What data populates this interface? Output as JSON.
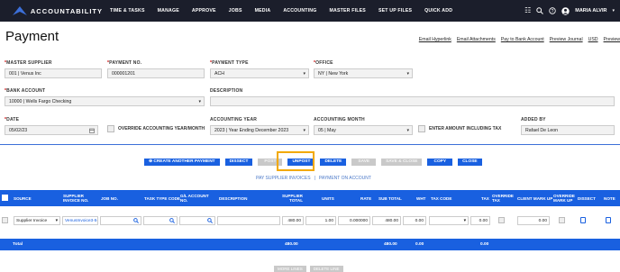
{
  "nav": {
    "brand": "ACCOUNTABILITY",
    "menu": [
      "TIME & TASKS",
      "MANAGE",
      "APPROVE",
      "JOBS",
      "MEDIA",
      "ACCOUNTING",
      "MASTER FILES",
      "SET UP FILES",
      "QUICK ADD"
    ],
    "user": "MARIA ALVIR"
  },
  "page_title": "Payment",
  "top_links": [
    "Email Hyperlink",
    "Email Attachments",
    "Pay to Bank Account",
    "Preview Journal",
    "USD",
    "Preview"
  ],
  "form": {
    "master_supplier": {
      "label": "MASTER SUPPLIER",
      "value": "001 | Venus Inc"
    },
    "payment_no": {
      "label": "PAYMENT NO.",
      "value": "000001201"
    },
    "payment_type": {
      "label": "PAYMENT TYPE",
      "value": "ACH"
    },
    "office": {
      "label": "OFFICE",
      "value": "NY | New York"
    },
    "bank_account": {
      "label": "BANK ACCOUNT",
      "value": "10000 | Wells Fargo Checking"
    },
    "description": {
      "label": "DESCRIPTION",
      "value": ""
    },
    "date": {
      "label": "DATE",
      "value": "05/02/23"
    },
    "override": {
      "label": "OVERRIDE ACCOUNTING YEAR/MONTH"
    },
    "accounting_year": {
      "label": "ACCOUNTING YEAR",
      "value": "2023 | Year Ending December 2023"
    },
    "accounting_month": {
      "label": "ACCOUNTING MONTH",
      "value": "05 | May"
    },
    "incl_tax": {
      "label": "ENTER AMOUNT INCLUDING TAX"
    },
    "added_by": {
      "label": "ADDED BY",
      "value": "Rafael De Leon"
    }
  },
  "buttons": {
    "create_another": "CREATE ANOTHER PAYMENT",
    "dissect": "DISSECT",
    "post": "POST",
    "unpost": "UNPOST",
    "delete": "DELETE",
    "save": "SAVE",
    "save_close": "SAVE & CLOSE",
    "copy": "COPY",
    "close": "CLOSE"
  },
  "sublinks": [
    "PAY SUPPLIER INVOICES",
    "|",
    "PAYMENT ON ACCOUNT"
  ],
  "table": {
    "headers": [
      "SOURCE",
      "SUPPLIER INVOICE NO.",
      "JOB NO.",
      "TASK TYPE CODE",
      "G/L ACCOUNT NO.",
      "DESCRIPTION",
      "SUPPLIER TOTAL",
      "UNITS",
      "RATE",
      "SUB TOTAL",
      "WHT",
      "TAX CODE",
      "TAX",
      "OVERRIDE TAX",
      "CLIENT MARK UP",
      "OVERRIDE MARK UP",
      "DISSECT",
      "NOTE"
    ],
    "row": {
      "source": "Supplier Invoice",
      "invoice": "VenusInvoice3-5-2",
      "supplier_total": "480.00",
      "units": "1.00",
      "rate": "0.000000",
      "sub_total": "480.00",
      "wht": "0.00",
      "tax": "0.00",
      "client_markup": "0.00"
    },
    "total": {
      "label": "Total",
      "supplier_total": "480.00",
      "sub_total": "480.00",
      "wht": "0.00",
      "tax": "0.00"
    }
  },
  "bottom_buttons": [
    "MORE LINES",
    "DELETE LINE"
  ],
  "colors": {
    "nav": "#1b1e2b",
    "accent": "#1960e0",
    "highlight": "#f2a900"
  }
}
